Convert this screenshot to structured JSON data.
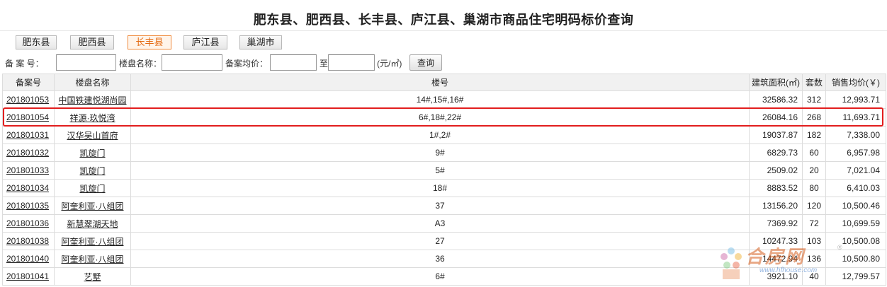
{
  "page": {
    "title": "肥东县、肥西县、长丰县、庐江县、巢湖市商品住宅明码标价查询"
  },
  "tabs": [
    {
      "label": "肥东县",
      "active": false
    },
    {
      "label": "肥西县",
      "active": false
    },
    {
      "label": "长丰县",
      "active": true
    },
    {
      "label": "庐江县",
      "active": false
    },
    {
      "label": "巢湖市",
      "active": false
    }
  ],
  "search": {
    "record_no_label": "备 案 号：",
    "record_no_value": "",
    "project_name_label": "楼盘名称：",
    "project_name_value": "",
    "avg_price_label": "备案均价：",
    "price_from_value": "",
    "to_label": "至",
    "price_to_value": "",
    "unit_label": "(元/㎡)",
    "query_button": "查询"
  },
  "table": {
    "headers": {
      "record_no": "备案号",
      "project_name": "楼盘名称",
      "building": "楼号",
      "area": "建筑面积(㎡)",
      "units": "套数",
      "avg_price": "销售均价(￥)"
    },
    "rows": [
      {
        "record_no": "201801053",
        "project_name": "中国铁建悦湖尚园",
        "building": "14#,15#,16#",
        "area": "32586.32",
        "units": "312",
        "avg_price": "12,993.71"
      },
      {
        "record_no": "201801054",
        "project_name": "祥源·玖悦湾",
        "building": "6#,18#,22#",
        "area": "26084.16",
        "units": "268",
        "avg_price": "11,693.71"
      },
      {
        "record_no": "201801031",
        "project_name": "汉华吴山首府",
        "building": "1#,2#",
        "area": "19037.87",
        "units": "182",
        "avg_price": "7,338.00"
      },
      {
        "record_no": "201801032",
        "project_name": "凯旋门",
        "building": "9#",
        "area": "6829.73",
        "units": "60",
        "avg_price": "6,957.98"
      },
      {
        "record_no": "201801033",
        "project_name": "凯旋门",
        "building": "5#",
        "area": "2509.02",
        "units": "20",
        "avg_price": "7,021.04"
      },
      {
        "record_no": "201801034",
        "project_name": "凯旋门",
        "building": "18#",
        "area": "8883.52",
        "units": "80",
        "avg_price": "6,410.03"
      },
      {
        "record_no": "201801035",
        "project_name": "阿奎利亚·八组团",
        "building": "37",
        "area": "13156.20",
        "units": "120",
        "avg_price": "10,500.46"
      },
      {
        "record_no": "201801036",
        "project_name": "新慧翠湖天地",
        "building": "A3",
        "area": "7369.92",
        "units": "72",
        "avg_price": "10,699.59"
      },
      {
        "record_no": "201801038",
        "project_name": "阿奎利亚·八组团",
        "building": "27",
        "area": "10247.33",
        "units": "103",
        "avg_price": "10,500.08"
      },
      {
        "record_no": "201801040",
        "project_name": "阿奎利亚·八组团",
        "building": "36",
        "area": "14472.94",
        "units": "136",
        "avg_price": "10,500.80"
      },
      {
        "record_no": "201801041",
        "project_name": "艺墅",
        "building": "6#",
        "area": "3921.10",
        "units": "40",
        "avg_price": "12,799.57"
      }
    ]
  },
  "watermark": {
    "text": "合房网",
    "url": "www.hfhouse.com",
    "mark": "®"
  },
  "colors": {
    "highlight_border": "#e21d1d",
    "active_tab_border": "#f08a3c",
    "active_tab_text": "#e46a11"
  }
}
